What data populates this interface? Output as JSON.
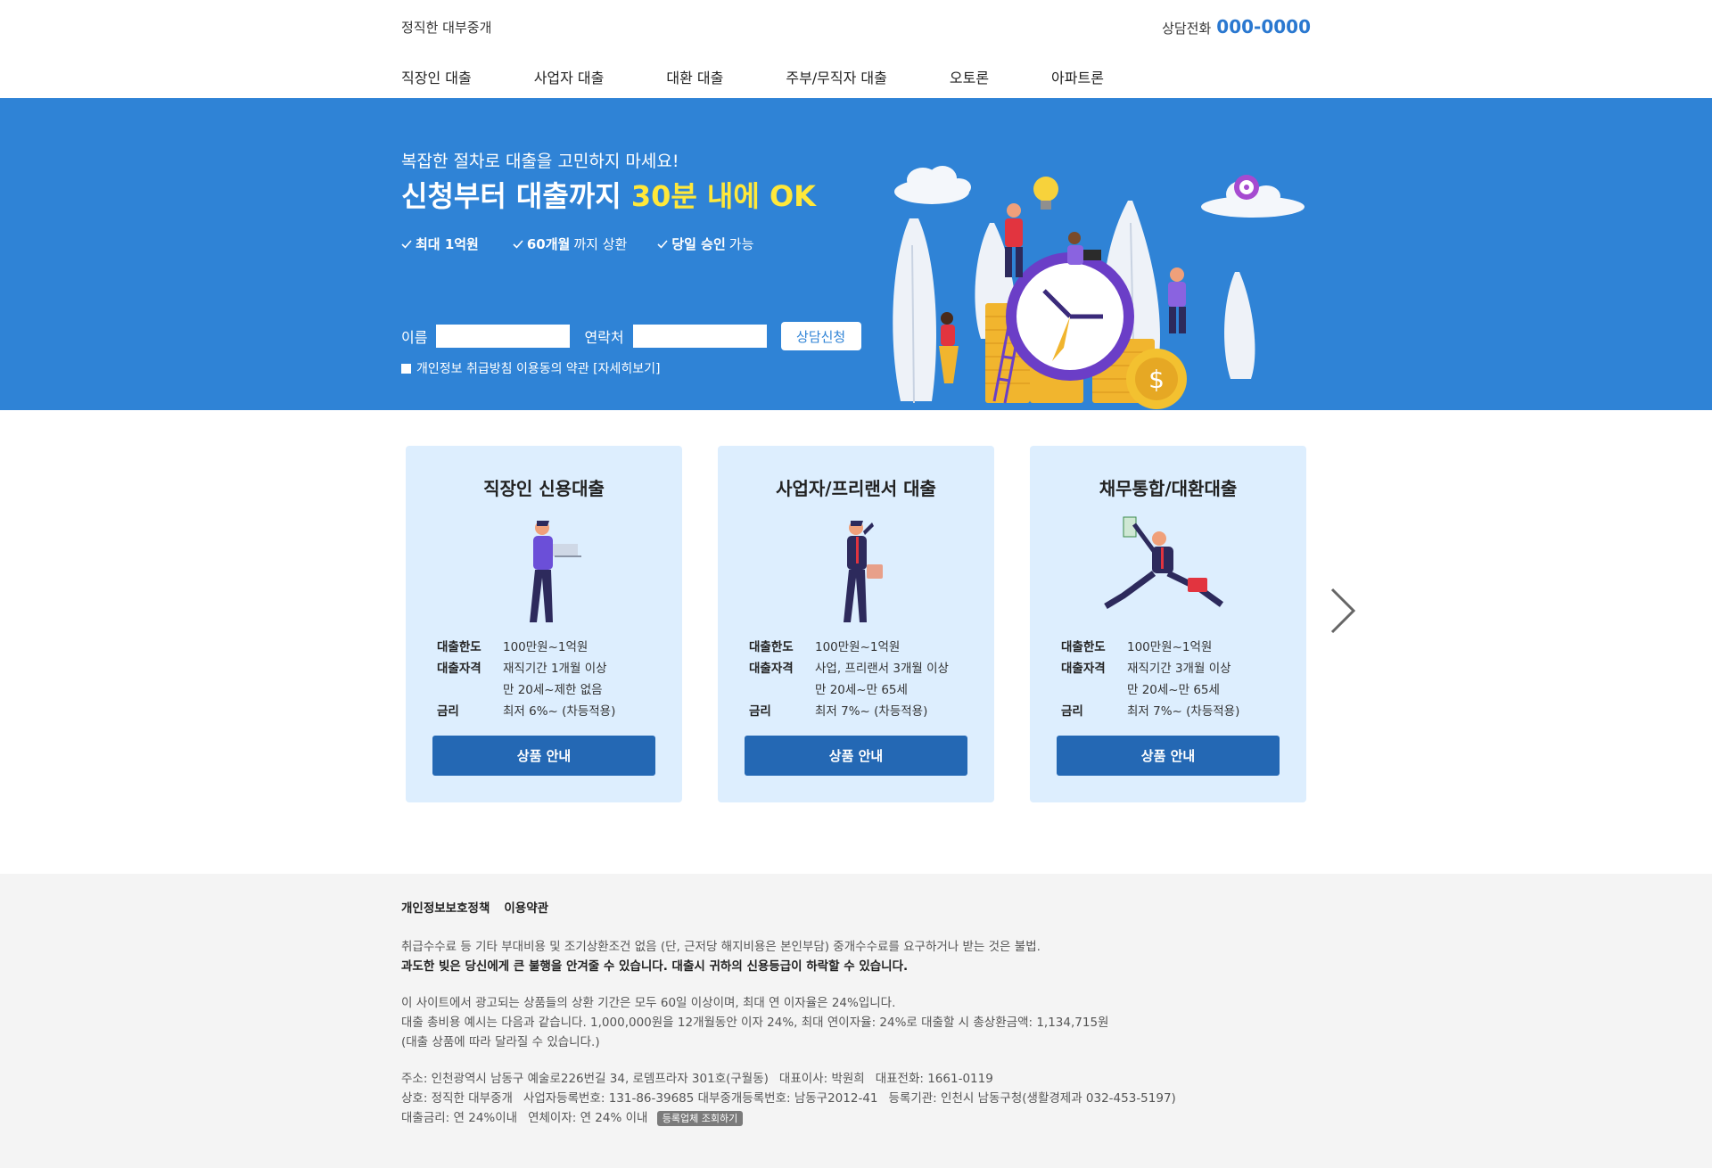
{
  "header": {
    "logo": "정직한 대부중개",
    "phone_label": "상담전화",
    "phone_number": "000-0000",
    "nav": [
      "직장인 대출",
      "사업자 대출",
      "대환 대출",
      "주부/무직자 대출",
      "오토론",
      "아파트론"
    ]
  },
  "hero": {
    "subtitle": "복잡한 절차로 대출을 고민하지 마세요!",
    "title_main": "신청부터 대출까지 ",
    "title_highlight": "30분 내에 OK",
    "highlight_color": "#ffe83a",
    "bg_color": "#2f83d6",
    "checks": [
      {
        "bold": "최대 1억원",
        "rest": ""
      },
      {
        "bold": "60개월",
        "rest": "까지 상환"
      },
      {
        "bold": "당일 승인",
        "rest": " 가능"
      }
    ],
    "form": {
      "name_label": "이름",
      "contact_label": "연락처",
      "name_value": "",
      "contact_value": "",
      "submit_label": "상담신청"
    },
    "agree_text": "개인정보 취급방침 이용동의 약관 [자세히보기]"
  },
  "cards": [
    {
      "title": "직장인 신용대출",
      "limit_label": "대출한도",
      "limit": "100만원~1억원",
      "qual_label": "대출자격",
      "qual1": "재직기간 1개월 이상",
      "qual2": "만 20세~제한 없음",
      "rate_label": "금리",
      "rate": "최저 6%~ (차등적용)",
      "button": "상품 안내"
    },
    {
      "title": "사업자/프리랜서 대출",
      "limit_label": "대출한도",
      "limit": "100만원~1억원",
      "qual_label": "대출자격",
      "qual1": "사업, 프리랜서 3개월 이상",
      "qual2": "만 20세~만 65세",
      "rate_label": "금리",
      "rate": "최저 7%~ (차등적용)",
      "button": "상품 안내"
    },
    {
      "title": "채무통합/대환대출",
      "limit_label": "대출한도",
      "limit": "100만원~1억원",
      "qual_label": "대출자격",
      "qual1": "재직기간 3개월 이상",
      "qual2": "만 20세~만 65세",
      "rate_label": "금리",
      "rate": "최저 7%~ (차등적용)",
      "button": "상품 안내"
    }
  ],
  "footer": {
    "links": [
      "개인정보보호정책",
      "이용약관"
    ],
    "notice1": "취급수수료 등 기타 부대비용 및 조기상환조건 없음 (단, 근저당 해지비용은 본인부담) 중개수수료를 요구하거나 받는 것은 불법.",
    "notice2": "과도한 빚은 당신에게 큰 불행을 안겨줄 수 있습니다. 대출시 귀하의 신용등급이 하락할 수 있습니다.",
    "info1": "이 사이트에서 광고되는 상품들의 상환 기간은 모두 60일 이상이며, 최대 연 이자율은 24%입니다.",
    "info2": "대출 총비용 예시는 다음과 같습니다. 1,000,000원을 12개월동안 이자 24%, 최대 연이자율: 24%로 대출할 시 총상환금액: 1,134,715원",
    "info3": "(대출 상품에 따라 달라질 수 있습니다.)",
    "addr": "주소: 인천광역시 남동구 예술로226번길 34, 로뎀프라자 301호(구월동)",
    "ceo": "대표이사: 박원희",
    "tel": "대표전화: 1661-0119",
    "company": "상호: 정직한 대부중개",
    "bizno": "사업자등록번호: 131-86-39685 대부중개등록번호: 남동구2012-41",
    "regorg": "등록기관: 인천시 남동구청(생활경제과 032-453-5197)",
    "rate": "대출금리: 연 24%이내",
    "overdue": "연체이자: 연 24% 이내",
    "badge": "등록업체 조회하기"
  }
}
